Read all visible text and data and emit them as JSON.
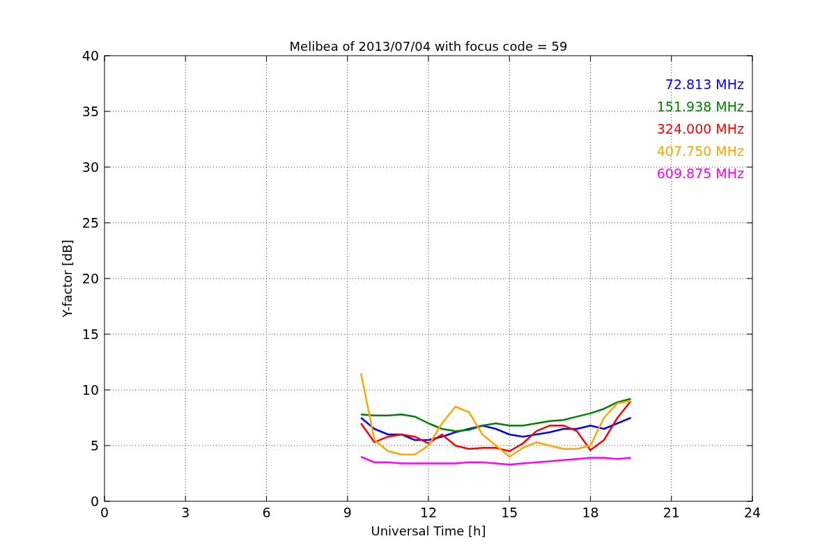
{
  "chart": {
    "chart_data": {
      "type": "line",
      "title": "Melibea of 2013/07/04 with focus code = 59",
      "xlabel": "Universal Time [h]",
      "ylabel": "Y-factor [dB]",
      "x": [
        9.5,
        10,
        10.5,
        11,
        11.5,
        12,
        12.5,
        13,
        13.5,
        14,
        14.5,
        15,
        15.5,
        16,
        16.5,
        17,
        17.5,
        18,
        18.5,
        19,
        19.5
      ],
      "series": [
        {
          "name": "72.813 MHz",
          "color": "#0000ff",
          "values": [
            7.5,
            6.5,
            6.0,
            6.0,
            5.5,
            5.5,
            5.8,
            6.2,
            6.5,
            6.8,
            6.5,
            6.0,
            5.8,
            6.0,
            6.2,
            6.5,
            6.5,
            6.8,
            6.5,
            7.0,
            7.5
          ]
        },
        {
          "name": "151.938 MHz",
          "color": "#008000",
          "values": [
            7.8,
            7.7,
            7.7,
            7.8,
            7.6,
            7.0,
            6.5,
            6.3,
            6.4,
            6.8,
            7.0,
            6.8,
            6.8,
            7.0,
            7.2,
            7.3,
            7.6,
            7.9,
            8.3,
            8.9,
            9.2
          ]
        },
        {
          "name": "324.000 MHz",
          "color": "#ff0000",
          "values": [
            7.0,
            5.3,
            5.8,
            6.0,
            5.8,
            5.2,
            6.0,
            5.0,
            4.7,
            4.8,
            4.8,
            4.5,
            5.2,
            6.3,
            6.8,
            6.8,
            6.3,
            4.6,
            5.5,
            7.5,
            9.0
          ]
        },
        {
          "name": "407.750 MHz",
          "color": "#ffa500",
          "values": [
            11.5,
            5.5,
            4.5,
            4.2,
            4.2,
            5.0,
            7.0,
            8.5,
            8.0,
            6.0,
            5.0,
            4.0,
            4.8,
            5.3,
            5.0,
            4.7,
            4.7,
            5.0,
            7.5,
            8.8,
            9.0
          ]
        },
        {
          "name": "609.875 MHz",
          "color": "#ff00ff",
          "values": [
            4.0,
            3.5,
            3.5,
            3.4,
            3.4,
            3.4,
            3.4,
            3.4,
            3.5,
            3.5,
            3.4,
            3.3,
            3.4,
            3.5,
            3.6,
            3.7,
            3.8,
            3.9,
            3.9,
            3.8,
            3.9
          ]
        }
      ],
      "grid": true,
      "xlim": [
        0,
        24
      ],
      "ylim": [
        0,
        40
      ],
      "xticks": [
        0,
        3,
        6,
        9,
        12,
        15,
        18,
        21,
        24
      ],
      "yticks": [
        0,
        5,
        10,
        15,
        20,
        25,
        30,
        35,
        40
      ]
    }
  }
}
